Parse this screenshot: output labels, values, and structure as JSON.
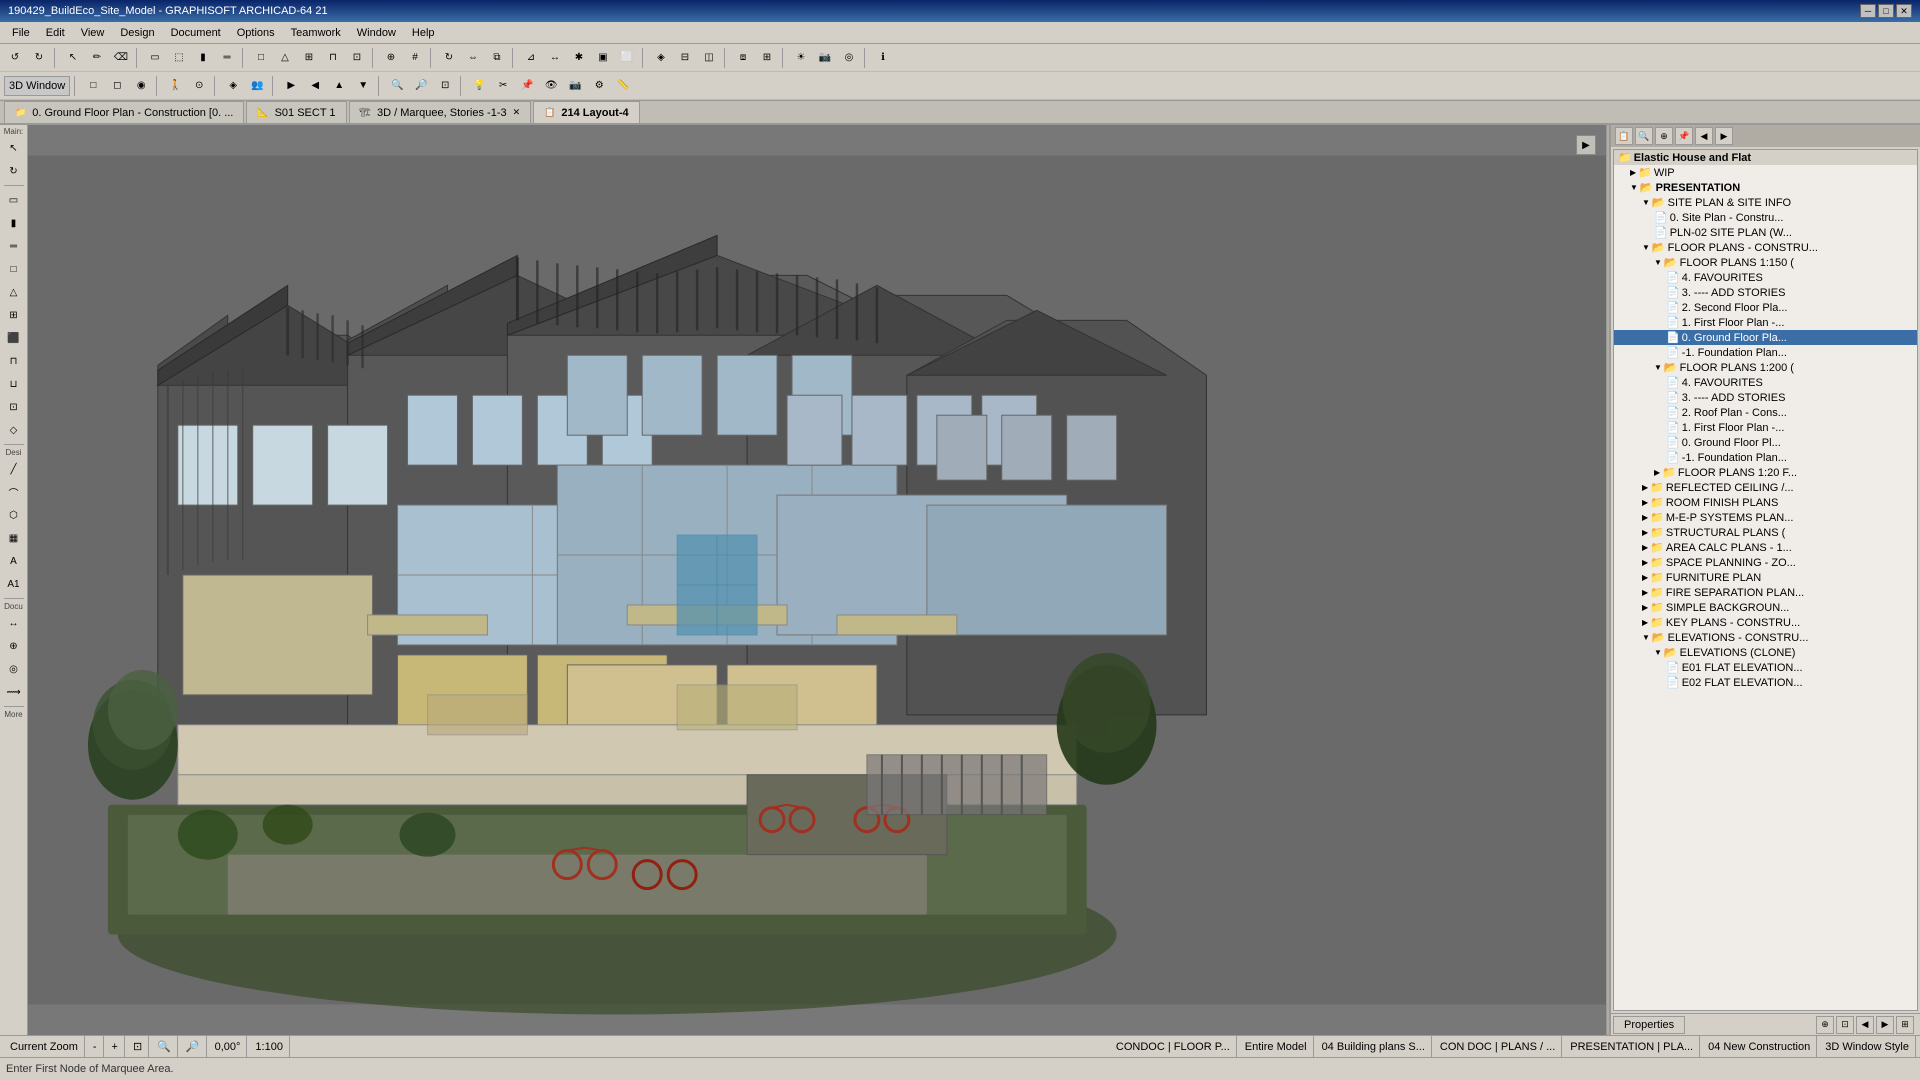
{
  "titleBar": {
    "title": "190429_BuildEco_Site_Model - GRAPHISOFT ARCHICAD-64 21",
    "minBtn": "─",
    "maxBtn": "□",
    "closeBtn": "✕"
  },
  "menuBar": {
    "items": [
      "File",
      "Edit",
      "View",
      "Design",
      "Document",
      "Options",
      "Teamwork",
      "Window",
      "Help"
    ]
  },
  "toolbar1": {
    "label3d": "3D Window"
  },
  "tabs": [
    {
      "id": "tab1",
      "icon": "📁",
      "label": "0. Ground Floor Plan - Construction [0. ...",
      "active": false,
      "closable": false
    },
    {
      "id": "tab2",
      "icon": "📐",
      "label": "S01 SECT 1",
      "active": false,
      "closable": false
    },
    {
      "id": "tab3",
      "icon": "🏗",
      "label": "3D / Marquee, Stories -1-3",
      "active": false,
      "closable": true
    },
    {
      "id": "tab4",
      "icon": "📋",
      "label": "214 Layout-4",
      "active": true,
      "closable": false
    }
  ],
  "projectTree": {
    "rootLabel": "Elastic House and Flat",
    "items": [
      {
        "level": 0,
        "type": "folder",
        "label": "Elastic House and Flat",
        "expanded": true
      },
      {
        "level": 1,
        "type": "item",
        "label": "WIP",
        "expanded": false
      },
      {
        "level": 1,
        "type": "folder",
        "label": "PRESENTATION",
        "expanded": true
      },
      {
        "level": 2,
        "type": "folder",
        "label": "SITE PLAN & SITE INFO",
        "expanded": true
      },
      {
        "level": 3,
        "type": "item",
        "label": "0. Site Plan - Constru..."
      },
      {
        "level": 3,
        "type": "item",
        "label": "PLN-02 SITE PLAN (W..."
      },
      {
        "level": 2,
        "type": "folder",
        "label": "FLOOR PLANS - CONSTRU...",
        "expanded": true
      },
      {
        "level": 3,
        "type": "folder",
        "label": "FLOOR PLANS 1:150 (",
        "expanded": true
      },
      {
        "level": 4,
        "type": "item",
        "label": "4. FAVOURITES"
      },
      {
        "level": 4,
        "type": "item",
        "label": "3. ---- ADD STORIES"
      },
      {
        "level": 4,
        "type": "item",
        "label": "2. Second Floor Pla..."
      },
      {
        "level": 4,
        "type": "item",
        "label": "1. First Floor Plan -..."
      },
      {
        "level": 4,
        "type": "item",
        "label": "0. Ground Floor Pla..."
      },
      {
        "level": 4,
        "type": "item",
        "label": "-1. Foundation Plan..."
      },
      {
        "level": 3,
        "type": "folder",
        "label": "FLOOR PLANS 1:200 (",
        "expanded": true
      },
      {
        "level": 4,
        "type": "item",
        "label": "4. FAVOURITES"
      },
      {
        "level": 4,
        "type": "item",
        "label": "3. ---- ADD STORIES"
      },
      {
        "level": 4,
        "type": "item",
        "label": "2. Roof Plan - Cons..."
      },
      {
        "level": 4,
        "type": "item",
        "label": "1. First Floor Plan -..."
      },
      {
        "level": 4,
        "type": "item",
        "label": "0. Ground Floor Pl..."
      },
      {
        "level": 4,
        "type": "item",
        "label": "-1. Foundation Plan..."
      },
      {
        "level": 3,
        "type": "folder",
        "label": "FLOOR PLANS 1:20 F...",
        "expanded": false
      },
      {
        "level": 2,
        "type": "folder",
        "label": "REFLECTED CEILING /...",
        "expanded": false
      },
      {
        "level": 2,
        "type": "folder",
        "label": "ROOM FINISH PLANS",
        "expanded": false
      },
      {
        "level": 2,
        "type": "folder",
        "label": "M-E-P SYSTEMS PLAN...",
        "expanded": false
      },
      {
        "level": 2,
        "type": "folder",
        "label": "STRUCTURAL PLANS (",
        "expanded": false
      },
      {
        "level": 2,
        "type": "folder",
        "label": "AREA CALC PLANS - 1...",
        "expanded": false
      },
      {
        "level": 2,
        "type": "folder",
        "label": "SPACE PLANNING - ZO...",
        "expanded": false
      },
      {
        "level": 2,
        "type": "folder",
        "label": "FURNITURE PLAN",
        "expanded": false
      },
      {
        "level": 2,
        "type": "folder",
        "label": "FIRE SEPARATION PLAN...",
        "expanded": false
      },
      {
        "level": 2,
        "type": "folder",
        "label": "SIMPLE BACKGROUN...",
        "expanded": false
      },
      {
        "level": 2,
        "type": "folder",
        "label": "KEY PLANS - CONSTRU...",
        "expanded": false
      },
      {
        "level": 2,
        "type": "folder",
        "label": "ELEVATIONS - CONSTRU...",
        "expanded": true
      },
      {
        "level": 3,
        "type": "folder",
        "label": "ELEVATIONS (CLONE)",
        "expanded": true
      },
      {
        "level": 4,
        "type": "item",
        "label": "E01 FLAT ELEVATION..."
      },
      {
        "level": 4,
        "type": "item",
        "label": "E02 FLAT ELEVATION..."
      }
    ]
  },
  "statusBar": {
    "zoom": "Current Zoom",
    "angle": "0,00°",
    "scale": "1:100",
    "layer": "CONDOC | FLOOR P...",
    "stories": "Entire Model",
    "buildingPlans": "04 Building plans S...",
    "conDoc": "CON DOC | PLANS / ...",
    "presentation": "PRESENTATION | PLA...",
    "newConstruction": "04 New Construction",
    "windowStyle": "3D Window Style"
  },
  "commandBar": {
    "message": "Enter First Node of Marquee Area."
  },
  "sectionLabels": {
    "main": "Main:",
    "desi": "Desi",
    "docu": "Docu",
    "more": "More"
  },
  "rightPanelTabs": {
    "properties": "Properties"
  },
  "icons": {
    "arrow": "▶",
    "arrowDown": "▼",
    "folder": "📁",
    "folderOpen": "📂",
    "doc": "📄",
    "expand": "▶",
    "collapse": "▼"
  }
}
